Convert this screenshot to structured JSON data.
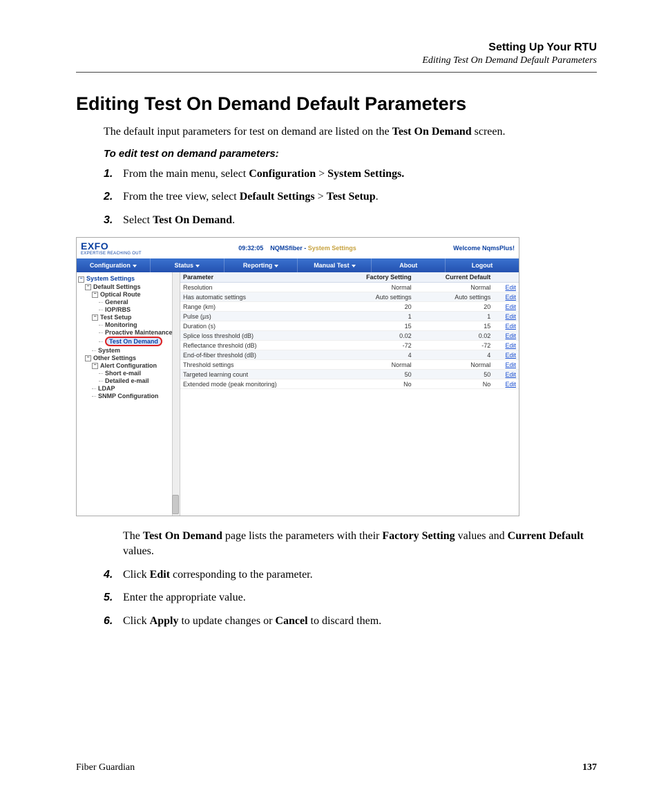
{
  "header": {
    "chapter": "Setting Up Your RTU",
    "section": "Editing Test On Demand Default Parameters"
  },
  "title": "Editing Test On Demand Default Parameters",
  "intro": {
    "pre": "The default input parameters for test on demand are listed on the ",
    "bold": "Test On Demand",
    "post": " screen."
  },
  "procedure_title": "To edit test on demand parameters:",
  "steps_a": [
    {
      "num": "1.",
      "plain": "From the main menu, select ",
      "b1": "Configuration",
      "mid": " > ",
      "b2": "System Settings."
    },
    {
      "num": "2.",
      "plain": "From the tree view, select ",
      "b1": "Default Settings",
      "mid": " > ",
      "b2": "Test Setup",
      "tail": "."
    },
    {
      "num": "3.",
      "plain": "Select ",
      "b1": "Test On Demand",
      "tail": "."
    }
  ],
  "app": {
    "logo": "EXFO",
    "tagline": "EXPERTISE REACHING OUT",
    "clock": "09:32:05",
    "product": "NQMSfiber",
    "sep": " - ",
    "page": "System Settings",
    "welcome": "Welcome NqmsPlus!",
    "menu": [
      "Configuration",
      "Status",
      "Reporting",
      "Manual Test",
      "About",
      "Logout"
    ],
    "tree": {
      "root": "System Settings",
      "default_settings": "Default Settings",
      "optical_route": "Optical Route",
      "general": "General",
      "iop_rbs": "IOP/RBS",
      "test_setup": "Test Setup",
      "monitoring": "Monitoring",
      "proactive": "Proactive Maintenance",
      "tod": "Test On Demand",
      "system": "System",
      "other": "Other Settings",
      "alert": "Alert Configuration",
      "short_email": "Short e-mail",
      "detailed_email": "Detailed e-mail",
      "ldap": "LDAP",
      "snmp": "SNMP Configuration"
    },
    "grid": {
      "headers": {
        "param": "Parameter",
        "factory": "Factory Setting",
        "current": "Current Default",
        "edit": ""
      },
      "edit_label": "Edit",
      "rows": [
        {
          "param": "Resolution",
          "factory": "Normal",
          "current": "Normal"
        },
        {
          "param": "Has automatic settings",
          "factory": "Auto settings",
          "current": "Auto settings"
        },
        {
          "param": "Range (km)",
          "factory": "20",
          "current": "20"
        },
        {
          "param": "Pulse (µs)",
          "factory": "1",
          "current": "1"
        },
        {
          "param": "Duration (s)",
          "factory": "15",
          "current": "15"
        },
        {
          "param": "Splice loss threshold (dB)",
          "factory": "0.02",
          "current": "0.02"
        },
        {
          "param": "Reflectance threshold (dB)",
          "factory": "-72",
          "current": "-72"
        },
        {
          "param": "End-of-fiber threshold (dB)",
          "factory": "4",
          "current": "4"
        },
        {
          "param": "Threshold settings",
          "factory": "Normal",
          "current": "Normal"
        },
        {
          "param": "Targeted learning count",
          "factory": "50",
          "current": "50"
        },
        {
          "param": "Extended mode (peak monitoring)",
          "factory": "No",
          "current": "No"
        }
      ]
    }
  },
  "after_shot": {
    "s1": "The ",
    "b1": "Test On Demand",
    "s2": " page lists the parameters with their ",
    "b2": "Factory Setting",
    "s3": " values and ",
    "b3": "Current Default",
    "s4": " values."
  },
  "steps_b": [
    {
      "num": "4.",
      "plain": "Click ",
      "b1": "Edit",
      "tail": " corresponding to the parameter."
    },
    {
      "num": "5.",
      "plain": "Enter the appropriate value."
    },
    {
      "num": "6.",
      "plain": "Click ",
      "b1": "Apply",
      "mid": " to update changes or ",
      "b2": "Cancel",
      "tail": " to discard them."
    }
  ],
  "footer": {
    "product": "Fiber Guardian",
    "page": "137"
  }
}
